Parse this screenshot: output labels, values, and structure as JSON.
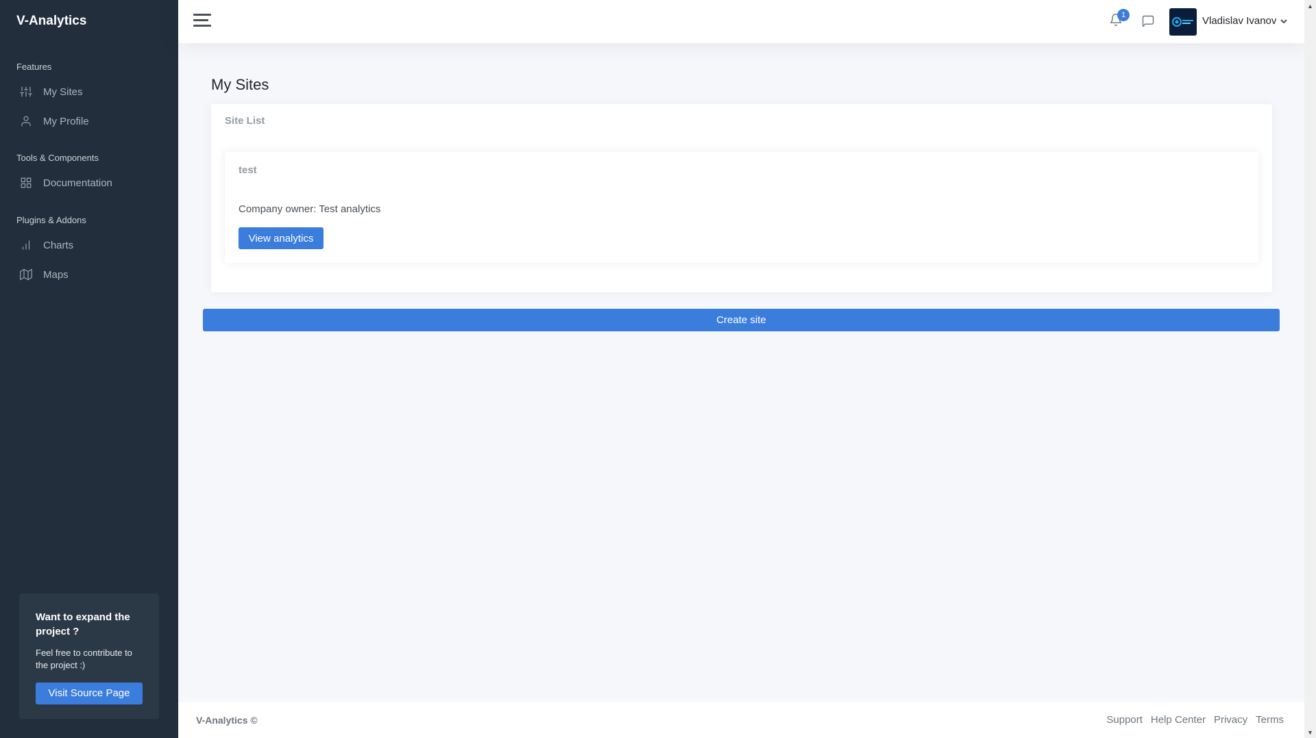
{
  "app": {
    "brand": "V-Analytics"
  },
  "sidebar": {
    "sections": [
      {
        "header": "Features"
      },
      {
        "header": "Tools & Components"
      },
      {
        "header": "Plugins & Addons"
      }
    ],
    "items": [
      {
        "label": "My Sites",
        "icon": "sliders-icon"
      },
      {
        "label": "My Profile",
        "icon": "user-icon"
      },
      {
        "label": "Documentation",
        "icon": "grid-icon"
      },
      {
        "label": "Charts",
        "icon": "bar-chart-icon"
      },
      {
        "label": "Maps",
        "icon": "map-icon"
      }
    ],
    "cta": {
      "title": "Want to expand the project ?",
      "text": "Feel free to contribute to the project :)",
      "button": "Visit Source Page"
    }
  },
  "topbar": {
    "notifications_count": "1",
    "user_name": "Vladislav Ivanov"
  },
  "main": {
    "page_title": "My Sites",
    "card_title": "Site List",
    "sites": [
      {
        "name": "test",
        "owner": "Company owner: Test analytics",
        "button": "View analytics"
      }
    ],
    "create_button": "Create site"
  },
  "footer": {
    "brand": "V-Analytics ©",
    "links": [
      "Support",
      "Help Center",
      "Privacy",
      "Terms"
    ]
  },
  "colors": {
    "sidebar_bg": "#222e3c",
    "accent": "#3b7ddd",
    "content_bg": "#f5f7fb"
  }
}
